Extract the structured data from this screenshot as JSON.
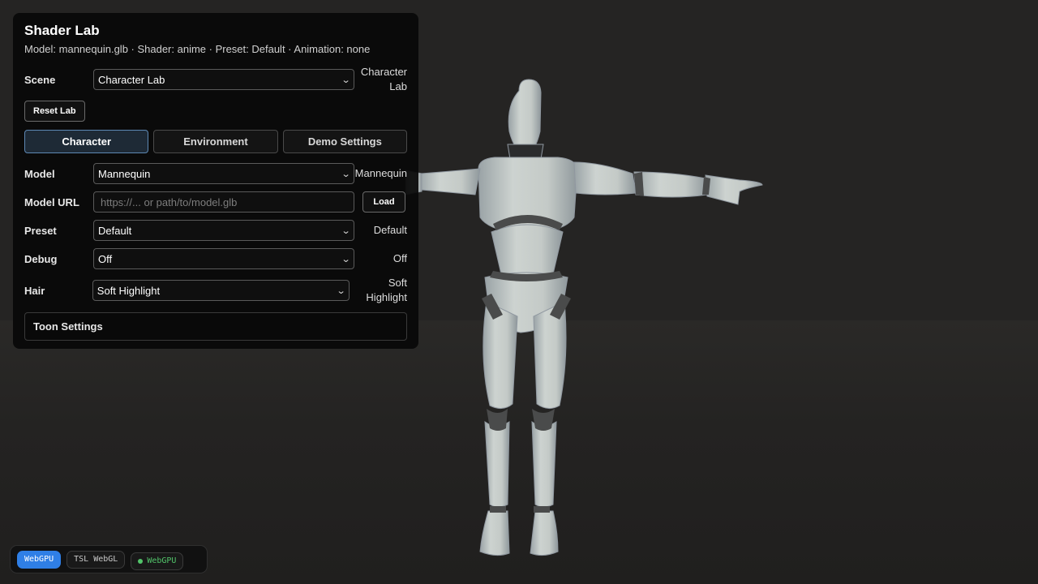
{
  "panel": {
    "title": "Shader Lab",
    "status": "Model: mannequin.glb · Shader: anime · Preset: Default · Animation: none",
    "scene": {
      "label": "Scene",
      "selected": "Character Lab",
      "value": "Character Lab"
    },
    "reset_label": "Reset Lab",
    "tabs": [
      {
        "label": "Character",
        "active": true
      },
      {
        "label": "Environment",
        "active": false
      },
      {
        "label": "Demo Settings",
        "active": false
      }
    ],
    "model": {
      "label": "Model",
      "selected": "Mannequin",
      "value": "Mannequin"
    },
    "model_url": {
      "label": "Model URL",
      "placeholder": "https://... or path/to/model.glb",
      "value": "",
      "button": "Load"
    },
    "preset": {
      "label": "Preset",
      "selected": "Default",
      "value": "Default"
    },
    "debug": {
      "label": "Debug",
      "selected": "Off",
      "value": "Off"
    },
    "hair": {
      "label": "Hair",
      "selected": "Soft Highlight",
      "value": "Soft Highlight"
    },
    "toon_settings_label": "Toon Settings"
  },
  "renderer_badges": [
    {
      "label": "WebGPU",
      "active": true
    },
    {
      "label": "TSL WebGL",
      "active": false
    },
    {
      "label": "WebGPU",
      "status": "green"
    }
  ],
  "colors": {
    "accent": "#2f7fe6",
    "active_tab_border": "#5d88b4",
    "status_green": "#52c46a",
    "figure_body": "#c9cfcb",
    "figure_joint": "#4a4b4b"
  },
  "icons": {
    "select_arrow": "chevron-down-icon",
    "status_dot": "status-dot-icon"
  }
}
